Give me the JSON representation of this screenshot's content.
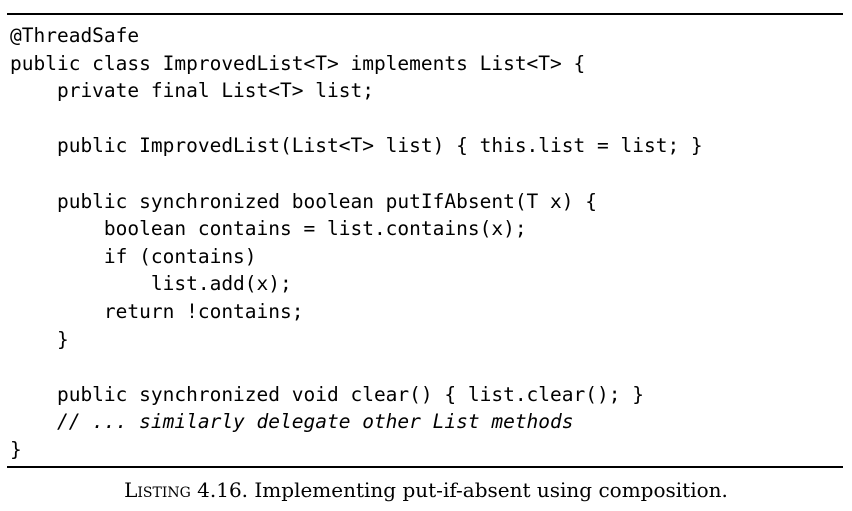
{
  "listing": {
    "lines": [
      {
        "text": "@ThreadSafe",
        "style": "code"
      },
      {
        "text": "public class ImprovedList<T> implements List<T> {",
        "style": "code"
      },
      {
        "text": "    private final List<T> list;",
        "style": "code"
      },
      {
        "text": "",
        "style": "code"
      },
      {
        "text": "    public ImprovedList(List<T> list) { this.list = list; }",
        "style": "code"
      },
      {
        "text": "",
        "style": "code"
      },
      {
        "text": "    public synchronized boolean putIfAbsent(T x) {",
        "style": "code"
      },
      {
        "text": "        boolean contains = list.contains(x);",
        "style": "code"
      },
      {
        "text": "        if (contains)",
        "style": "code"
      },
      {
        "text": "            list.add(x);",
        "style": "code"
      },
      {
        "text": "        return !contains;",
        "style": "code"
      },
      {
        "text": "    }",
        "style": "code"
      },
      {
        "text": "",
        "style": "code"
      },
      {
        "text": "    public synchronized void clear() { list.clear(); }",
        "style": "code"
      },
      {
        "text": "    // ... similarly delegate other List methods",
        "style": "comment"
      },
      {
        "text": "}",
        "style": "code"
      }
    ]
  },
  "caption": {
    "label": "Listing 4.16.",
    "text": " Implementing put-if-absent using composition."
  }
}
